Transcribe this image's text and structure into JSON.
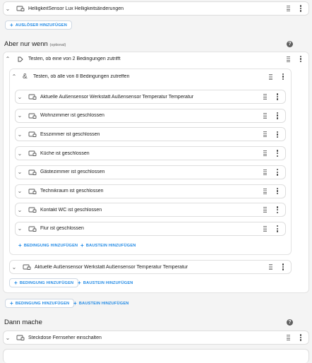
{
  "trigger": {
    "label": "HelligkeitSensor Lux Helligkeitsänderungen",
    "icon": "trigger-device-icon"
  },
  "add_trigger_label": "AUSLÖSER HINZUFÜGEN",
  "conditions_section": {
    "title": "Aber nur wenn",
    "optional": "(optional)"
  },
  "or_block": {
    "label": "Testen, ob eine von 2 Bedingungen zutrifft",
    "icon": "or-condition-icon"
  },
  "and_block": {
    "label": "Testen, ob alle von 8 Bedingungen zutreffen",
    "icon": "and-condition-icon"
  },
  "and_items": [
    {
      "label": "Aktuelle Außensensor Werkstatt Außensensor Temperatur Temperatur"
    },
    {
      "label": "Wohnzimmer ist geschlossen"
    },
    {
      "label": "Esszimmer ist geschlossen"
    },
    {
      "label": "Küche ist geschlossen"
    },
    {
      "label": "Gästezimmer ist geschlossen"
    },
    {
      "label": "Technikraum ist geschlossen"
    },
    {
      "label": "Kontakt WC ist geschlossen"
    },
    {
      "label": "Flur ist geschlossen"
    }
  ],
  "inner_add_condition": "BEDINGUNG HINZUFÜGEN",
  "inner_add_block": "BAUSTEIN HINZUFÜGEN",
  "or_item": {
    "label": "Aktuelle Außensensor Werkstatt Außensensor Temperatur Temperatur"
  },
  "or_add_condition": "BEDINGUNG HINZUFÜGEN",
  "or_add_block": "BAUSTEIN HINZUFÜGEN",
  "outer_add_condition": "BEDINGUNG HINZUFÜGEN",
  "outer_add_block": "BAUSTEIN HINZUFÜGEN",
  "actions_section": {
    "title": "Dann mache"
  },
  "action": {
    "label": "Steckdose Fernseher einschalten",
    "icon": "action-device-icon"
  },
  "colors": {
    "accent": "#1e88e5",
    "background": "#f4f4f4",
    "border": "#dedede"
  }
}
